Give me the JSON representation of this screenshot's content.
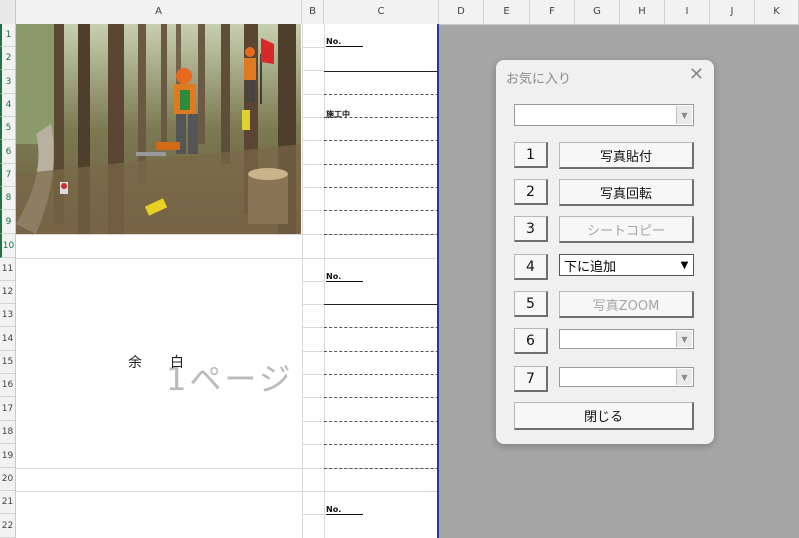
{
  "columns": [
    "A",
    "B",
    "C",
    "D",
    "E",
    "F",
    "G",
    "H",
    "I",
    "J",
    "K"
  ],
  "rows": [
    "1",
    "2",
    "3",
    "4",
    "5",
    "6",
    "7",
    "8",
    "9",
    "10",
    "11",
    "12",
    "13",
    "14",
    "15",
    "16",
    "17",
    "18",
    "19",
    "20",
    "21",
    "22"
  ],
  "sheet": {
    "no_label_1": "No.",
    "koshu_label": "施工中",
    "no_label_2": "No.",
    "no_label_3": "No.",
    "blank_text": "余白",
    "page_watermark": "1ページ"
  },
  "dialog": {
    "title": "お気に入り",
    "close_icon": "close-icon",
    "top_combo_value": "",
    "buttons": [
      {
        "num": "1",
        "label": "写真貼付",
        "enabled": true
      },
      {
        "num": "2",
        "label": "写真回転",
        "enabled": true
      },
      {
        "num": "3",
        "label": "シートコピー",
        "enabled": false
      },
      {
        "num": "4",
        "label": "下に追加",
        "type": "dropdown"
      },
      {
        "num": "5",
        "label": "写真ZOOM",
        "enabled": false
      },
      {
        "num": "6",
        "label": "",
        "type": "combo"
      },
      {
        "num": "7",
        "label": "",
        "type": "combo"
      }
    ],
    "close_button": "閉じる"
  }
}
